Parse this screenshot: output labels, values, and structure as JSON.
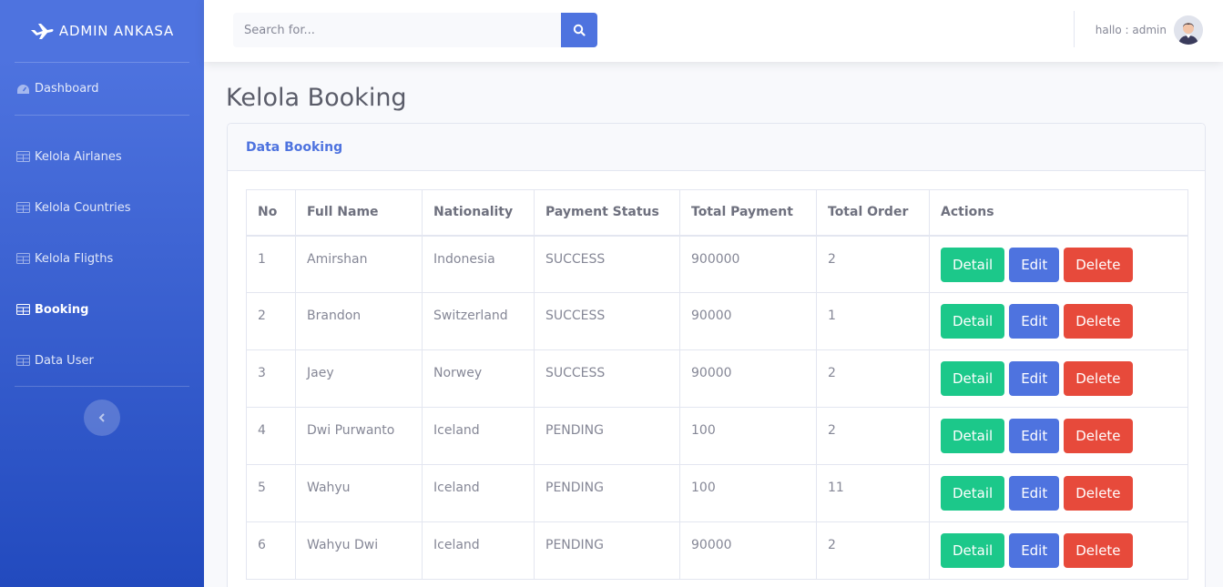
{
  "sidebar": {
    "brand": "ADMIN ANKASA",
    "items": [
      {
        "label": "Dashboard"
      },
      {
        "label": "Kelola Airlanes"
      },
      {
        "label": "Kelola Countries"
      },
      {
        "label": "Kelola Fligths"
      },
      {
        "label": "Booking"
      },
      {
        "label": "Data User"
      }
    ]
  },
  "topbar": {
    "search_placeholder": "Search for...",
    "user_greeting": "hallo : admin"
  },
  "main": {
    "title": "Kelola Booking",
    "card_title": "Data Booking",
    "columns": [
      "No",
      "Full Name",
      "Nationality",
      "Payment Status",
      "Total Payment",
      "Total Order",
      "Actions"
    ],
    "actions": {
      "detail": "Detail",
      "edit": "Edit",
      "delete": "Delete"
    },
    "rows": [
      [
        "1",
        "Amirshan",
        "Indonesia",
        "SUCCESS",
        "900000",
        "2"
      ],
      [
        "2",
        "Brandon",
        "Switzerland",
        "SUCCESS",
        "90000",
        "1"
      ],
      [
        "3",
        "Jaey",
        "Norwey",
        "SUCCESS",
        "90000",
        "2"
      ],
      [
        "4",
        "Dwi Purwanto",
        "Iceland",
        "PENDING",
        "100",
        "2"
      ],
      [
        "5",
        "Wahyu",
        "Iceland",
        "PENDING",
        "100",
        "11"
      ],
      [
        "6",
        "Wahyu Dwi",
        "Iceland",
        "PENDING",
        "90000",
        "2"
      ]
    ]
  },
  "colors": {
    "primary": "#4e73df",
    "success": "#1cc88a",
    "danger": "#e74a3b"
  }
}
